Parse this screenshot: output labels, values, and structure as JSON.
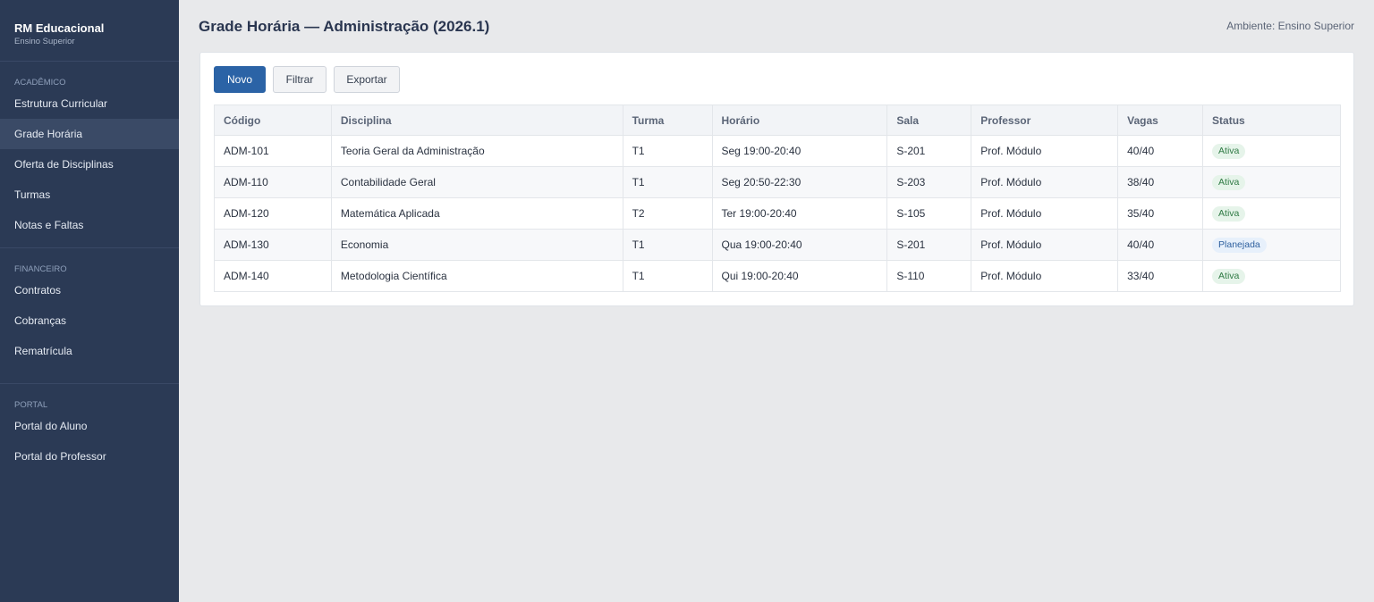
{
  "app": {
    "name": "RM Educacional",
    "subtitle": "Ensino Superior"
  },
  "sidebar": {
    "sections": [
      {
        "label": "ACADÊMICO",
        "items": [
          "Estrutura Curricular",
          "Grade Horária",
          "Oferta de Disciplinas",
          "Turmas",
          "Notas e Faltas"
        ]
      },
      {
        "label": "FINANCEIRO",
        "items": [
          "Contratos",
          "Cobranças",
          "Rematrícula"
        ]
      },
      {
        "label": "PORTAL",
        "items": [
          "Portal do Aluno",
          "Portal do Professor"
        ]
      }
    ],
    "active_item": "Grade Horária"
  },
  "header": {
    "title": "Grade Horária — Administração (2026.1)",
    "environment": "Ambiente: Ensino Superior"
  },
  "toolbar": {
    "new_label": "Novo",
    "filter_label": "Filtrar",
    "export_label": "Exportar"
  },
  "table": {
    "columns": [
      "Código",
      "Disciplina",
      "Turma",
      "Horário",
      "Sala",
      "Professor",
      "Vagas",
      "Status"
    ],
    "rows": [
      {
        "codigo": "ADM-101",
        "disciplina": "Teoria Geral da Administração",
        "turma": "T1",
        "horario": "Seg 19:00-20:40",
        "sala": "S-201",
        "professor": "Prof. Módulo",
        "vagas": "40/40",
        "status": "Ativa"
      },
      {
        "codigo": "ADM-110",
        "disciplina": "Contabilidade Geral",
        "turma": "T1",
        "horario": "Seg 20:50-22:30",
        "sala": "S-203",
        "professor": "Prof. Módulo",
        "vagas": "38/40",
        "status": "Ativa"
      },
      {
        "codigo": "ADM-120",
        "disciplina": "Matemática Aplicada",
        "turma": "T2",
        "horario": "Ter 19:00-20:40",
        "sala": "S-105",
        "professor": "Prof. Módulo",
        "vagas": "35/40",
        "status": "Ativa"
      },
      {
        "codigo": "ADM-130",
        "disciplina": "Economia",
        "turma": "T1",
        "horario": "Qua 19:00-20:40",
        "sala": "S-201",
        "professor": "Prof. Módulo",
        "vagas": "40/40",
        "status": "Planejada"
      },
      {
        "codigo": "ADM-140",
        "disciplina": "Metodologia Científica",
        "turma": "T1",
        "horario": "Qui 19:00-20:40",
        "sala": "S-110",
        "professor": "Prof. Módulo",
        "vagas": "33/40",
        "status": "Ativa"
      }
    ]
  },
  "colors": {
    "sidebar_bg": "#2b3a55",
    "primary": "#2b63a6",
    "status_ativa": "#2f7a44",
    "status_planejada": "#2d5f9e"
  }
}
